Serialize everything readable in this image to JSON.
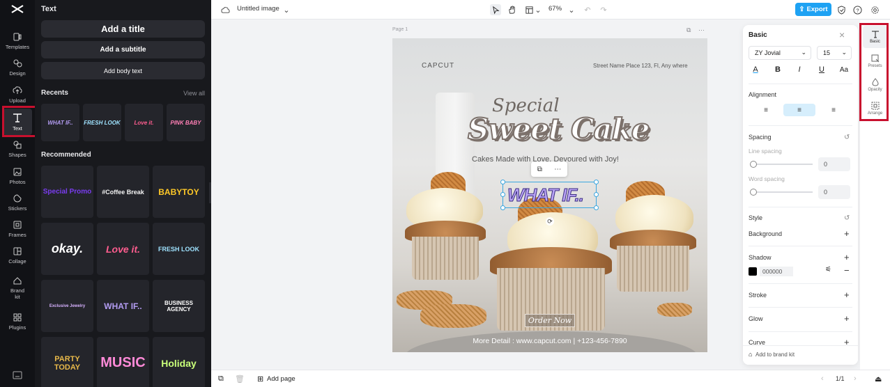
{
  "app": {
    "logo_icon": "capcut-logo-icon",
    "document_title": "Untitled image",
    "zoom": "67%",
    "export_label": "Export"
  },
  "rail": {
    "items": [
      {
        "label": "Templates",
        "icon": "templates-icon"
      },
      {
        "label": "Design",
        "icon": "design-icon"
      },
      {
        "label": "Upload",
        "icon": "upload-icon"
      },
      {
        "label": "Text",
        "icon": "text-icon"
      },
      {
        "label": "Shapes",
        "icon": "shapes-icon"
      },
      {
        "label": "Photos",
        "icon": "photos-icon"
      },
      {
        "label": "Stickers",
        "icon": "stickers-icon"
      },
      {
        "label": "Frames",
        "icon": "frames-icon"
      },
      {
        "label": "Collage",
        "icon": "collage-icon"
      },
      {
        "label": "Brand kit",
        "icon": "brand-kit-icon"
      },
      {
        "label": "Plugins",
        "icon": "plugins-icon"
      }
    ],
    "active": "Text"
  },
  "library": {
    "title": "Text",
    "add_title": "Add a title",
    "add_subtitle": "Add a subtitle",
    "add_body": "Add body text",
    "recents_label": "Recents",
    "view_all": "View all",
    "recents": [
      {
        "text": "WHAT IF..",
        "color": "#b39cf2"
      },
      {
        "text": "FRESH LOOK",
        "color": "#9fe3ff"
      },
      {
        "text": "Love it.",
        "color": "#ff5d8f"
      },
      {
        "text": "PINK BABY",
        "color": "#ff7fb5"
      }
    ],
    "recommended_label": "Recommended",
    "recommended": [
      {
        "text": "Special Promo",
        "color": "#7a3cf0"
      },
      {
        "text": "#Coffee Break",
        "color": "#f3f3f3"
      },
      {
        "text": "BABYTOY",
        "color": "#ffc927"
      },
      {
        "text": "okay.",
        "color": "#ffffff"
      },
      {
        "text": "Love it.",
        "color": "#ff5d8f"
      },
      {
        "text": "FRESH LOOK",
        "color": "#9fe3ff"
      },
      {
        "text": "Exclusive Jewelry",
        "color": "#d7b2ff"
      },
      {
        "text": "WHAT IF..",
        "color": "#b39cf2"
      },
      {
        "text": "BUSINESS AGENCY",
        "color": "#ffffff"
      },
      {
        "text": "PARTY TODAY",
        "color": "#e8b94a"
      },
      {
        "text": "MUSIC",
        "color": "#ff8ad8"
      },
      {
        "text": "Holiday",
        "color": "#c9ff7a"
      }
    ]
  },
  "canvas": {
    "page_label": "Page 1",
    "poster": {
      "logo": "CAPCUT",
      "address": "Street Name Place 123, Fl, Any where",
      "title_line1": "Special",
      "title_line2": "Sweet Cake",
      "subtitle": "Cakes Made with Love, Devoured with Joy!",
      "order_button": "Order Now",
      "footer": "More Detail : www.capcut.com | +123-456-7890"
    },
    "selected_text": "WHAT IF.."
  },
  "bottombar": {
    "add_page": "Add page",
    "page_count": "1/1"
  },
  "properties": {
    "title": "Basic",
    "font": "ZY Jovial",
    "font_size": "15",
    "alignment_label": "Alignment",
    "alignment_active": "center",
    "spacing_label": "Spacing",
    "line_spacing_label": "Line spacing",
    "line_spacing_value": "0",
    "word_spacing_label": "Word spacing",
    "word_spacing_value": "0",
    "style_label": "Style",
    "background_label": "Background",
    "shadow_label": "Shadow",
    "shadow_color": "000000",
    "stroke_label": "Stroke",
    "glow_label": "Glow",
    "curve_label": "Curve",
    "brand_kit": "Add to brand kit"
  },
  "right_rail": {
    "items": [
      {
        "label": "Basic",
        "icon": "text-basic-icon"
      },
      {
        "label": "Presets",
        "icon": "presets-icon"
      },
      {
        "label": "Opacity",
        "icon": "opacity-icon"
      },
      {
        "label": "Arrange",
        "icon": "arrange-icon"
      }
    ],
    "active": "Basic"
  },
  "colors": {
    "accent": "#1ea2f3",
    "highlight_box": "#c8102e",
    "selection": "#3aa6e0"
  }
}
